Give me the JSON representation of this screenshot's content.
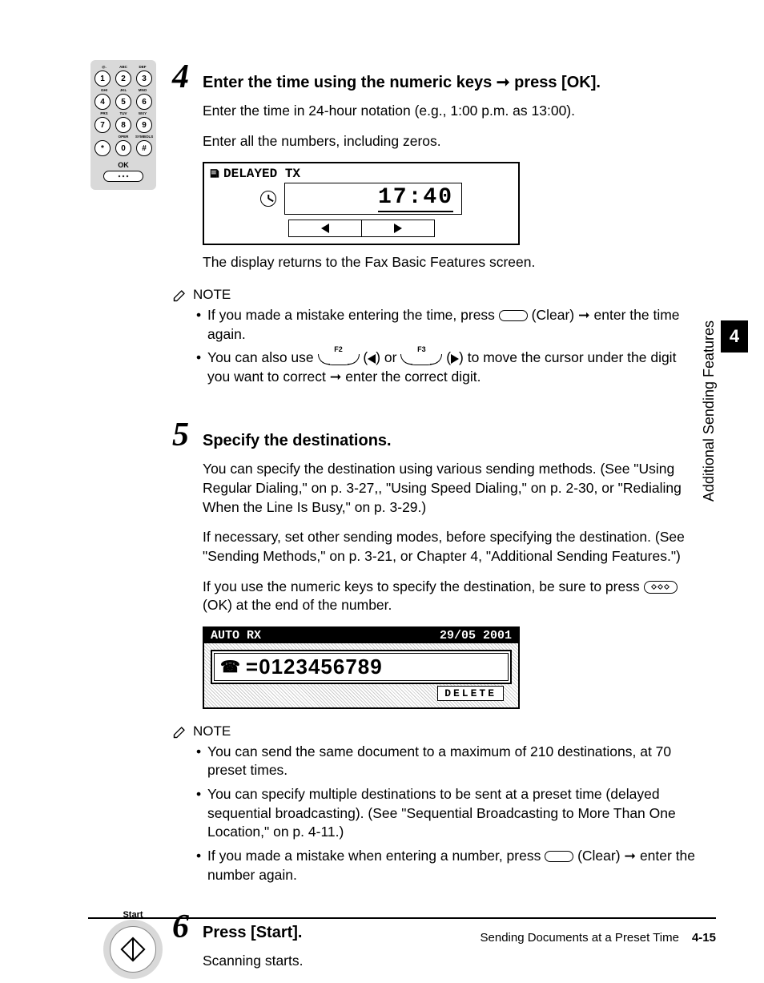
{
  "keypad": {
    "labels_row1": [
      "@.",
      "ABC",
      "DEF"
    ],
    "labels_row2": [
      "GHI",
      "JKL",
      "MNO"
    ],
    "labels_row3": [
      "PRS",
      "TUV",
      "WXY"
    ],
    "labels_row4": [
      "",
      "OPER",
      "SYMBOLS"
    ],
    "keys_row1": [
      "1",
      "2",
      "3"
    ],
    "keys_row2": [
      "4",
      "5",
      "6"
    ],
    "keys_row3": [
      "7",
      "8",
      "9"
    ],
    "keys_row4": [
      "*",
      "0",
      "#"
    ],
    "ok_label": "OK"
  },
  "step4": {
    "number": "4",
    "heading_a": "Enter the time using the numeric keys ",
    "heading_b": " press [OK].",
    "p1": "Enter the time in 24-hour notation (e.g., 1:00 p.m. as 13:00).",
    "p2": "Enter all the numbers, including zeros.",
    "display_title": "DELAYED TX",
    "display_time": "17:40",
    "after_display": "The display returns to the Fax Basic Features screen.",
    "note_label": "NOTE",
    "note1_a": "If you made a mistake entering the time, press ",
    "note1_b": " (Clear) ",
    "note1_c": " enter the time again.",
    "note2_a": "You can also use ",
    "note2_f2": "F2",
    "note2_b": " (",
    "note2_c": ") or ",
    "note2_f3": "F3",
    "note2_d": " (",
    "note2_e": ") to move the cursor under the digit you want to correct ",
    "note2_f": " enter the correct digit."
  },
  "step5": {
    "number": "5",
    "heading": "Specify the destinations.",
    "p1": "You can specify the destination using various sending methods. (See \"Using Regular Dialing,\" on p. 3-27,, \"Using Speed Dialing,\" on p. 2-30, or \"Redialing When the Line Is Busy,\" on p. 3-29.)",
    "p2": "If necessary, set other sending modes, before specifying the destination. (See \"Sending Methods,\" on p. 3-21, or Chapter 4, \"Additional Sending Features.\")",
    "p3_a": "If you use the numeric keys to specify the destination, be sure to press ",
    "p3_b": " (OK) at the end of the number.",
    "display_mode": "AUTO RX",
    "display_date": "29/05 2001",
    "display_number": "=0123456789",
    "display_delete": "DELETE",
    "note_label": "NOTE",
    "note1": "You can send the same document to a maximum of 210 destinations, at 70 preset times.",
    "note2": "You can specify multiple destinations to be sent at a preset time (delayed sequential broadcasting). (See \"Sequential Broadcasting to More Than One Location,\" on p. 4-11.)",
    "note3_a": "If you made a mistake when entering a number, press ",
    "note3_b": " (Clear) ",
    "note3_c": " enter the number again."
  },
  "step6": {
    "number": "6",
    "heading": "Press [Start].",
    "start_label": "Start",
    "p1": "Scanning starts."
  },
  "side": {
    "chapter_num": "4",
    "chapter_title": "Additional Sending Features"
  },
  "footer": {
    "title": "Sending Documents at a Preset Time",
    "page": "4-15"
  }
}
